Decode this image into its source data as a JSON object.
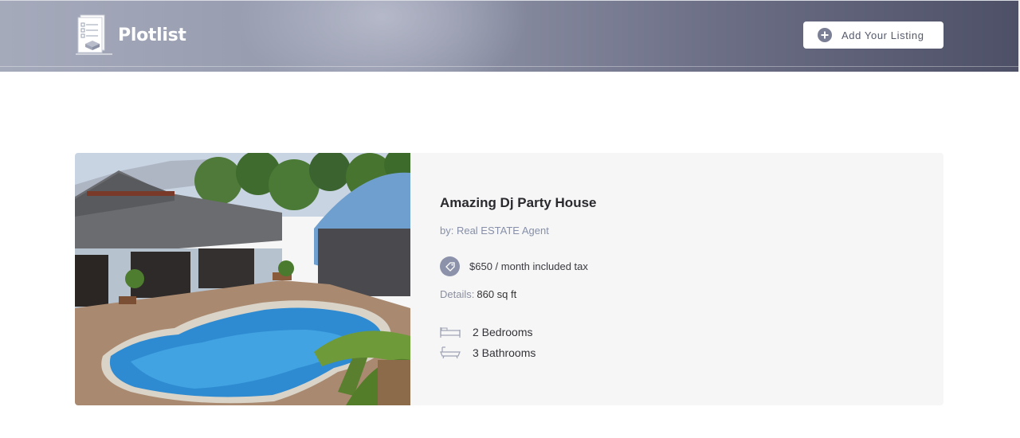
{
  "header": {
    "brand": "Plotlist",
    "add_listing_label": "Add Your Listing"
  },
  "listing": {
    "title": "Amazing Dj Party House",
    "agent": "by: Real ESTATE Agent",
    "price": "$650 / month included tax",
    "details_label": "Details:",
    "details_value": "860 sq ft",
    "bedrooms": "2 Bedrooms",
    "bathrooms": "3 Bathrooms",
    "image_description_icon": "pool-house-photo"
  },
  "icons": {
    "logo": "document-stack-icon",
    "add": "plus-circle-icon",
    "price": "money-tag-icon",
    "bed": "bed-icon",
    "bath": "bathtub-icon"
  },
  "colors": {
    "header_start": "#a5aabb",
    "header_end": "#4d5066",
    "accent": "#8b92aa",
    "card_bg": "#f6f6f7"
  }
}
